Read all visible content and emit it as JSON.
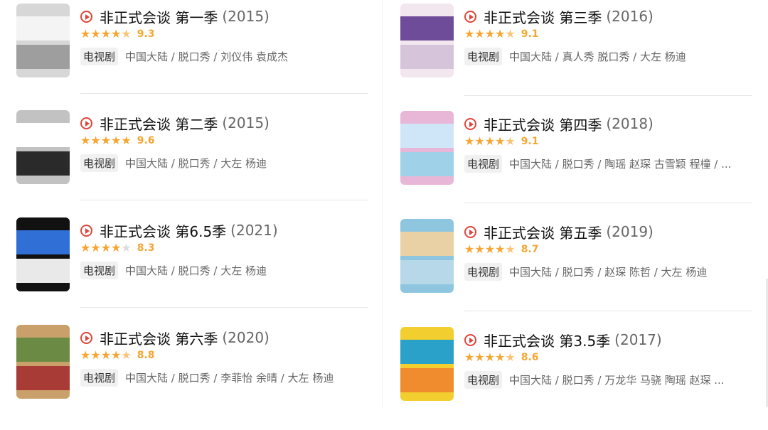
{
  "left": [
    {
      "title": "非正式会谈 第一季",
      "year": "(2015)",
      "stars": [
        "full",
        "full",
        "full",
        "full",
        "half"
      ],
      "score": "9.3",
      "tag": "电视剧",
      "meta": "中国大陆 / 脱口秀 / 刘仪伟 袁成杰",
      "poster_colors": [
        "#d7d7d7",
        "#f4f4f4",
        "#9e9e9e"
      ]
    },
    {
      "title": "非正式会谈 第二季",
      "year": "(2015)",
      "stars": [
        "full",
        "full",
        "full",
        "full",
        "full"
      ],
      "score": "9.6",
      "tag": "电视剧",
      "meta": "中国大陆 / 脱口秀 / 大左 杨迪",
      "poster_colors": [
        "#c2c2c2",
        "#ffffff",
        "#2a2a2a"
      ]
    },
    {
      "title": "非正式会谈 第6.5季",
      "year": "(2021)",
      "stars": [
        "full",
        "full",
        "full",
        "full",
        "empty"
      ],
      "score": "8.3",
      "tag": "电视剧",
      "meta": "中国大陆 / 脱口秀 / 大左 杨迪",
      "poster_colors": [
        "#111111",
        "#2f6fd6",
        "#e9e9e9"
      ]
    },
    {
      "title": "非正式会谈 第六季",
      "year": "(2020)",
      "stars": [
        "full",
        "full",
        "full",
        "full",
        "half"
      ],
      "score": "8.8",
      "tag": "电视剧",
      "meta": "中国大陆 / 脱口秀 / 李菲怡 余晴 / 大左 杨迪",
      "poster_colors": [
        "#c9a06a",
        "#6b8b45",
        "#a83b35"
      ]
    }
  ],
  "right": [
    {
      "title": "非正式会谈 第三季",
      "year": "(2016)",
      "stars": [
        "full",
        "full",
        "full",
        "full",
        "half"
      ],
      "score": "9.1",
      "tag": "电视剧",
      "meta": "中国大陆 / 真人秀 脱口秀 / 大左 杨迪",
      "poster_colors": [
        "#f3e7ef",
        "#6e4c9a",
        "#d6c4da"
      ]
    },
    {
      "title": "非正式会谈 第四季",
      "year": "(2018)",
      "stars": [
        "full",
        "full",
        "full",
        "full",
        "half"
      ],
      "score": "9.1",
      "tag": "电视剧",
      "meta": "中国大陆 / 脱口秀 / 陶瑶 赵琛 古雪颖 程橦 / ...",
      "poster_colors": [
        "#e8b7d7",
        "#cfe6f8",
        "#9fd1e8"
      ]
    },
    {
      "title": "非正式会谈 第五季",
      "year": "(2019)",
      "stars": [
        "full",
        "full",
        "full",
        "full",
        "half"
      ],
      "score": "8.7",
      "tag": "电视剧",
      "meta": "中国大陆 / 脱口秀 / 赵琛 陈哲 / 大左 杨迪",
      "poster_colors": [
        "#8fc6df",
        "#e9d1a5",
        "#b7d8e8"
      ]
    },
    {
      "title": "非正式会谈 第3.5季",
      "year": "(2017)",
      "stars": [
        "full",
        "full",
        "full",
        "full",
        "half"
      ],
      "score": "8.6",
      "tag": "电视剧",
      "meta": "中国大陆 / 脱口秀 / 万龙华 马骁 陶瑶 赵琛 ...",
      "poster_colors": [
        "#f2cf2e",
        "#2aa1c9",
        "#f08c2e"
      ]
    }
  ]
}
